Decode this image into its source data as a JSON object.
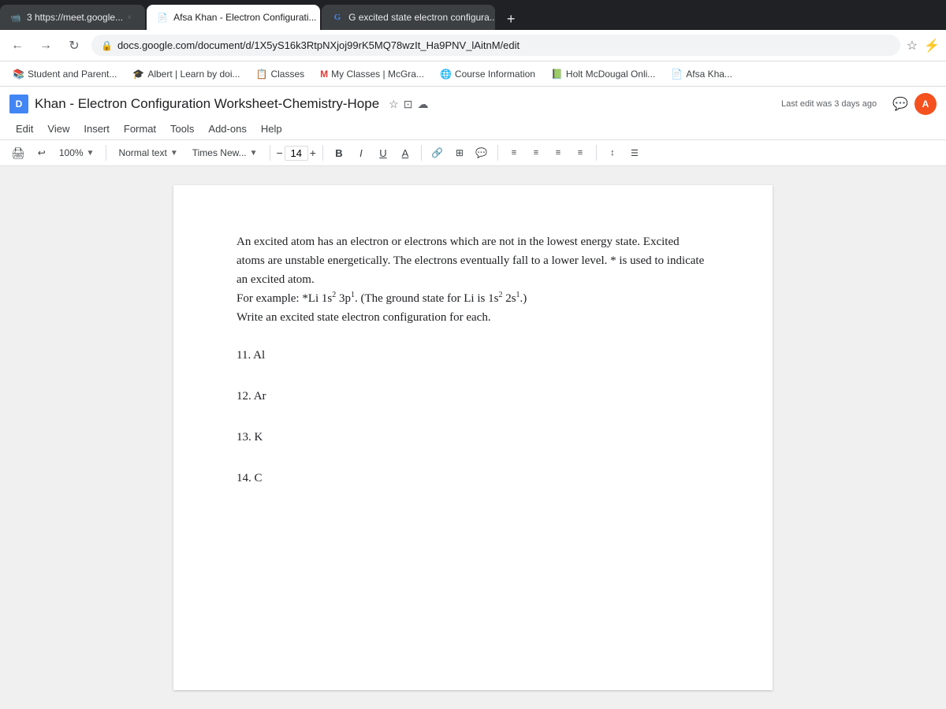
{
  "browser": {
    "tabs": [
      {
        "id": "tab1",
        "label": "3 https://meet.google...",
        "icon": "📹",
        "active": false
      },
      {
        "id": "tab2",
        "label": "Afsa Khan - Electron Configurati...",
        "icon": "📄",
        "active": true
      },
      {
        "id": "tab3",
        "label": "G excited state electron configura...",
        "icon": "G",
        "active": false
      }
    ],
    "url": "docs.google.com/document/d/1X5yS16k3RtpNXjoj99rK5MQ78wzIt_Ha9PNV_lAitnM/edit",
    "add_tab_label": "+"
  },
  "bookmarks": [
    {
      "label": "Student and Parent...",
      "icon": "📚"
    },
    {
      "label": "Albert | Learn by doi...",
      "icon": "🎓"
    },
    {
      "label": "Classes",
      "icon": "📋"
    },
    {
      "label": "My Classes | McGra...",
      "icon": "M"
    },
    {
      "label": "Course Information",
      "icon": "🌐"
    },
    {
      "label": "Holt McDougal Onli...",
      "icon": "📗"
    },
    {
      "label": "Afsa Kha...",
      "icon": "📄"
    }
  ],
  "docs": {
    "title": "Khan - Electron Configuration Worksheet-Chemistry-Hope",
    "last_edit": "Last edit was 3 days ago",
    "menu_items": [
      "Edit",
      "View",
      "Insert",
      "Format",
      "Tools",
      "Add-ons",
      "Help"
    ],
    "toolbar": {
      "zoom": "100%",
      "style": "Normal text",
      "font": "Times New...",
      "font_size": "14",
      "bold": "B",
      "italic": "I",
      "underline": "U",
      "strikethrough": "A"
    }
  },
  "document": {
    "intro": "An excited atom has an electron or electrons which are not in the lowest energy state. Excited atoms are unstable energetically. The electrons eventually fall to a lower level. * is used to indicate an excited atom.",
    "example": "For example: *Li 1s² 3p¹. (The ground state for Li is 1s² 2s¹.)",
    "instruction": "Write an excited state electron configuration for each.",
    "questions": [
      {
        "number": "11.",
        "element": "Al"
      },
      {
        "number": "12.",
        "element": "Ar"
      },
      {
        "number": "13.",
        "element": "K"
      },
      {
        "number": "14.",
        "element": "C"
      }
    ]
  }
}
